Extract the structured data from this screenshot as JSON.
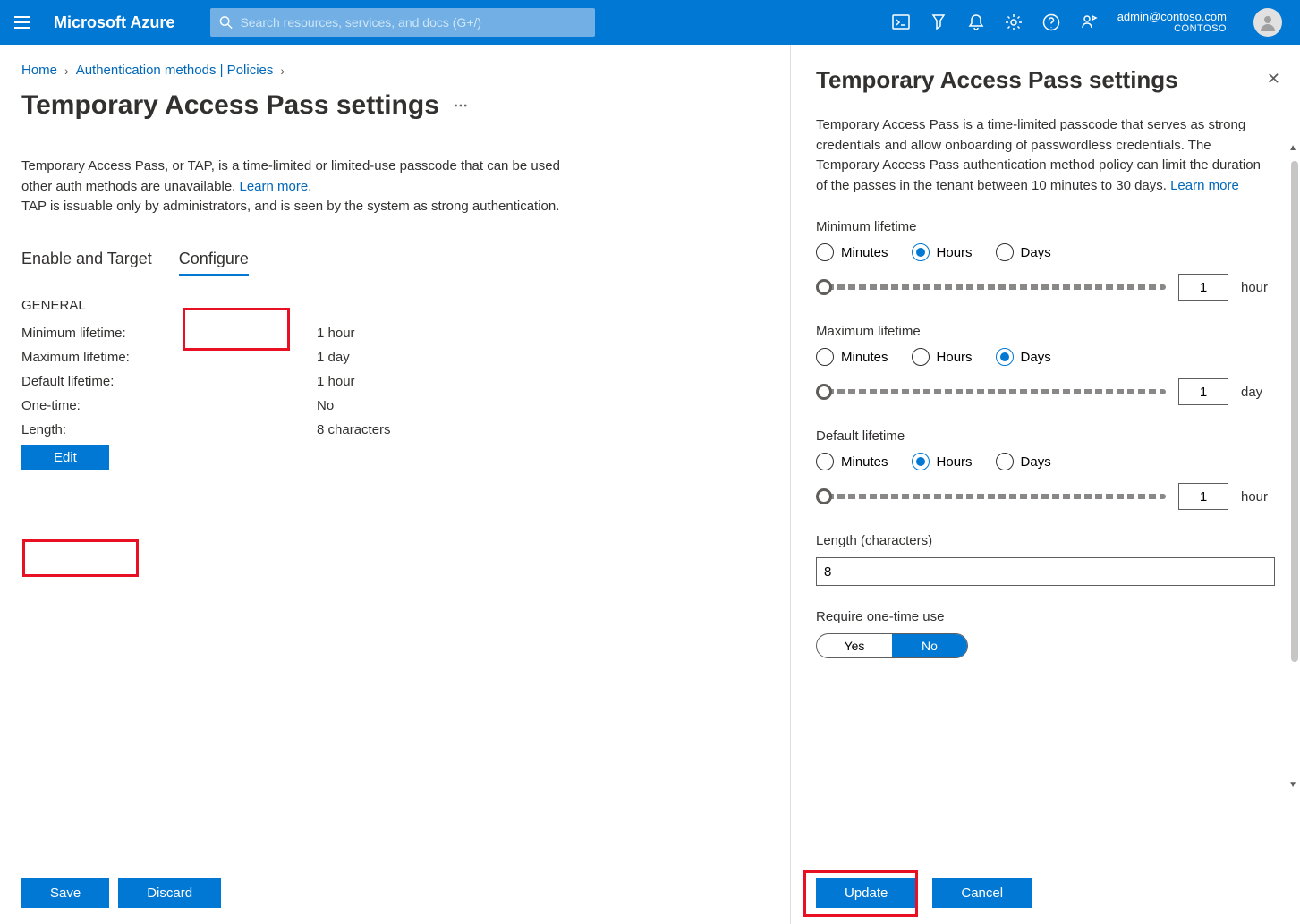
{
  "topbar": {
    "brand": "Microsoft Azure",
    "search_placeholder": "Search resources, services, and docs (G+/)",
    "user_email": "admin@contoso.com",
    "tenant": "CONTOSO"
  },
  "breadcrumb": {
    "home": "Home",
    "auth": "Authentication methods | Policies"
  },
  "page": {
    "title": "Temporary Access Pass settings",
    "desc_line1_a": "Temporary Access Pass, or TAP, is a time-limited or limited-use passcode that can be used",
    "desc_line1_b": "other auth methods are unavailable. ",
    "learn_more": "Learn more",
    "desc_line2": "TAP is issuable only by administrators, and is seen by the system as strong authentication.",
    "tabs": {
      "enable": "Enable and Target",
      "configure": "Configure"
    },
    "section": "GENERAL",
    "kv": {
      "min_k": "Minimum lifetime:",
      "min_v": "1 hour",
      "max_k": "Maximum lifetime:",
      "max_v": "1 day",
      "def_k": "Default lifetime:",
      "def_v": "1 hour",
      "one_k": "One-time:",
      "one_v": "No",
      "len_k": "Length:",
      "len_v": "8 characters"
    },
    "edit_btn": "Edit",
    "save_btn": "Save",
    "discard_btn": "Discard"
  },
  "panel": {
    "title": "Temporary Access Pass settings",
    "desc": "Temporary Access Pass is a time-limited passcode that serves as strong credentials and allow onboarding of passwordless credentials. The Temporary Access Pass authentication method policy can limit the duration of the passes in the tenant between 10 minutes to 30 days. ",
    "learn_more": "Learn more",
    "min_label": "Minimum lifetime",
    "max_label": "Maximum lifetime",
    "def_label": "Default lifetime",
    "radio": {
      "minutes": "Minutes",
      "hours": "Hours",
      "days": "Days"
    },
    "min_selected": "hours",
    "min_value": "1",
    "min_unit": "hour",
    "max_selected": "days",
    "max_value": "1",
    "max_unit": "day",
    "def_selected": "hours",
    "def_value": "1",
    "def_unit": "hour",
    "len_label": "Length (characters)",
    "len_value": "8",
    "one_label": "Require one-time use",
    "yes": "Yes",
    "no": "No",
    "one_selected": "no",
    "update_btn": "Update",
    "cancel_btn": "Cancel"
  }
}
